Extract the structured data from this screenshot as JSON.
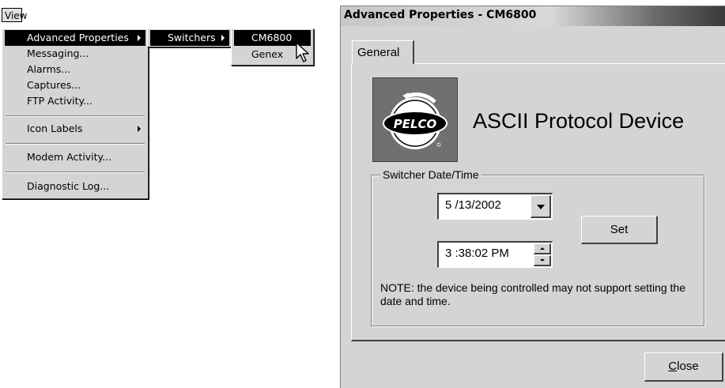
{
  "menubar": {
    "view_label": "View"
  },
  "view_menu": {
    "items": [
      {
        "label": "Advanced Properties"
      },
      {
        "label": "Messaging..."
      },
      {
        "label": "Alarms..."
      },
      {
        "label": "Captures..."
      },
      {
        "label": "FTP Activity..."
      },
      {
        "label": "Icon Labels"
      },
      {
        "label": "Modem Activity..."
      },
      {
        "label": "Diagnostic Log..."
      }
    ]
  },
  "advanced_submenu": {
    "items": [
      {
        "label": "Switchers"
      }
    ]
  },
  "switchers_submenu": {
    "items": [
      {
        "label": "CM6800"
      },
      {
        "label": "Genex"
      }
    ]
  },
  "dialog": {
    "title": "Advanced Properties - CM6800",
    "tab_general": "General",
    "logo_text": "PELCO",
    "device_heading": "ASCII Protocol Device",
    "group_label": "Switcher Date/Time",
    "date_value": "5 /13/2002",
    "time_value": "3 :38:02 PM",
    "set_button": "Set",
    "note": "NOTE: the device being controlled may not support setting the date and time.",
    "close_button_first": "C",
    "close_button_rest": "lose"
  },
  "icons": [
    "submenu-arrow-icon",
    "mouse-cursor-icon",
    "dropdown-arrow-icon",
    "spin-up-icon",
    "spin-down-icon",
    "pelco-logo"
  ],
  "colors": {
    "menu_bg": "#d4d4d4",
    "selection": "#000000",
    "dialog_bg": "#d4d4d4"
  }
}
